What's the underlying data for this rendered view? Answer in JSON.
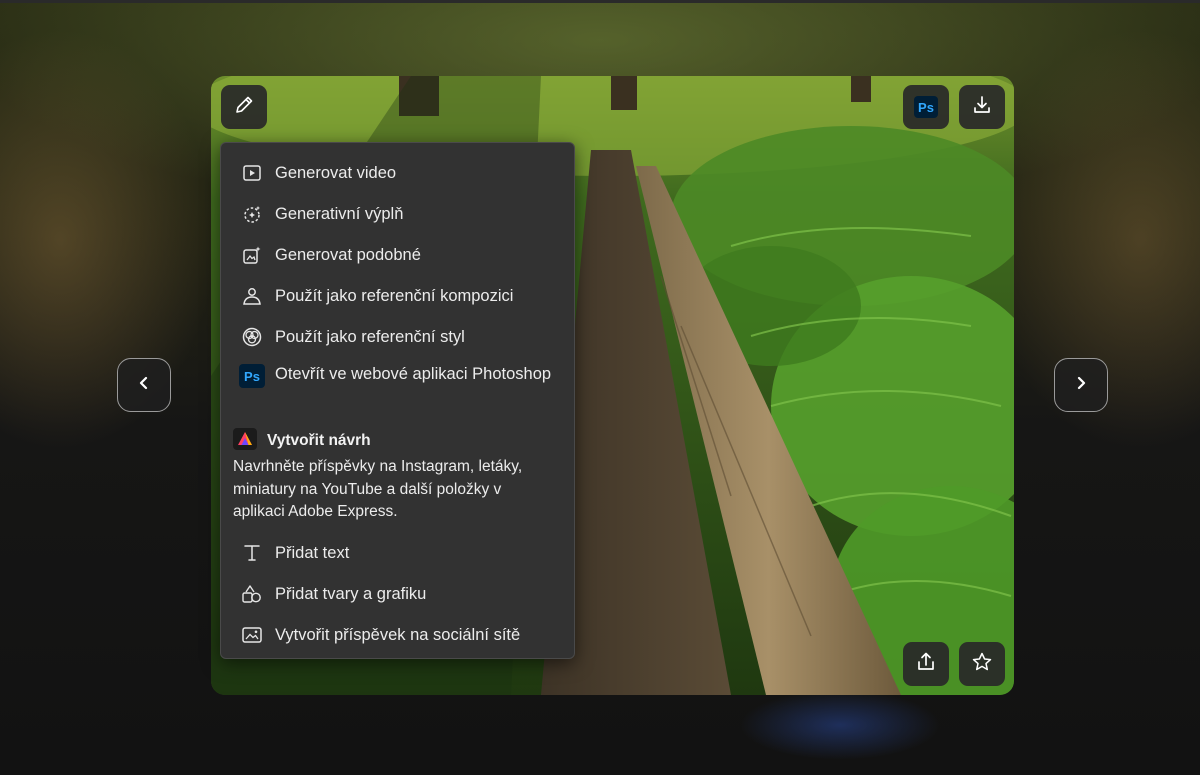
{
  "viewer": {
    "prev_icon": "chevron-left-icon",
    "next_icon": "chevron-right-icon",
    "toolbar": {
      "edit_icon": "pencil-icon",
      "photoshop_badge": "Ps",
      "download_icon": "download-icon",
      "share_icon": "share-icon",
      "favorite_icon": "star-icon"
    }
  },
  "menu": {
    "items": [
      {
        "label": "Generovat video",
        "icon": "video-play-icon"
      },
      {
        "label": "Generativní výplň",
        "icon": "generative-fill-icon"
      },
      {
        "label": "Generovat podobné",
        "icon": "generate-similar-icon"
      },
      {
        "label": "Použít jako referenční kompozici",
        "icon": "composition-reference-icon"
      },
      {
        "label": "Použít jako referenční styl",
        "icon": "style-reference-icon"
      },
      {
        "label": "Otevřít ve webové aplikaci Photoshop",
        "icon": "photoshop-icon",
        "badge": "Ps"
      }
    ],
    "design": {
      "title": "Vytvořit návrh",
      "icon": "adobe-express-icon",
      "description": "Navrhněte příspěvky na Instagram, letáky, miniatury na YouTube a další položky v aplikaci Adobe Express."
    },
    "express_items": [
      {
        "label": "Přidat text",
        "icon": "text-icon"
      },
      {
        "label": "Přidat tvary a grafiku",
        "icon": "shapes-icon"
      },
      {
        "label": "Vytvořit příspěvek na sociální sítě",
        "icon": "social-post-icon"
      }
    ]
  },
  "colors": {
    "menu_bg": "#323232",
    "photoshop_blue": "#31a8ff",
    "photoshop_bg": "#001e36"
  }
}
